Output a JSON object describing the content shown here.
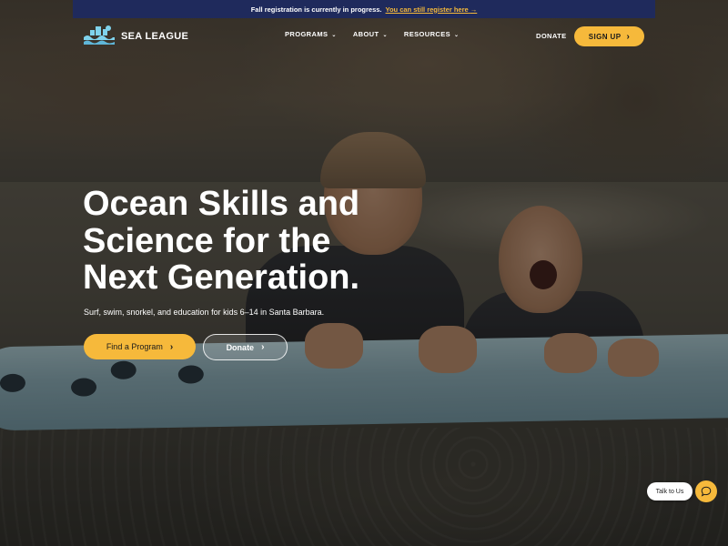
{
  "announcement": {
    "text": "Fall registration is currently in progress.",
    "link_text": "You can still register here",
    "link_arrow": "→"
  },
  "brand": {
    "name": "SEA LEAGUE",
    "logo_icon": "wave-castle-logo-icon"
  },
  "nav": {
    "items": [
      {
        "label": "PROGRAMS",
        "icon": "chevron-down-icon"
      },
      {
        "label": "ABOUT",
        "icon": "chevron-down-icon"
      },
      {
        "label": "RESOURCES",
        "icon": "chevron-down-icon"
      }
    ],
    "donate_label": "DONATE",
    "signup_label": "SIGN UP",
    "signup_icon": "chevron-right-icon"
  },
  "hero": {
    "title_lines": [
      "Ocean Skills and",
      "Science for the",
      "Next Generation."
    ],
    "subtitle": "Surf, swim, snorkel, and education for kids 6–14 in Santa Barbara.",
    "primary_cta": "Find a Program",
    "secondary_cta": "Donate",
    "cta_icon": "chevron-right-icon",
    "background_image": "two children in wetsuits holding a surfboard in the ocean"
  },
  "chat": {
    "label": "Talk to Us",
    "icon": "chat-bubble-icon"
  },
  "colors": {
    "accent": "#f6b93b",
    "announcement_bg": "#1f2a5c",
    "link": "#f5b93a",
    "text_light": "#ffffff"
  }
}
